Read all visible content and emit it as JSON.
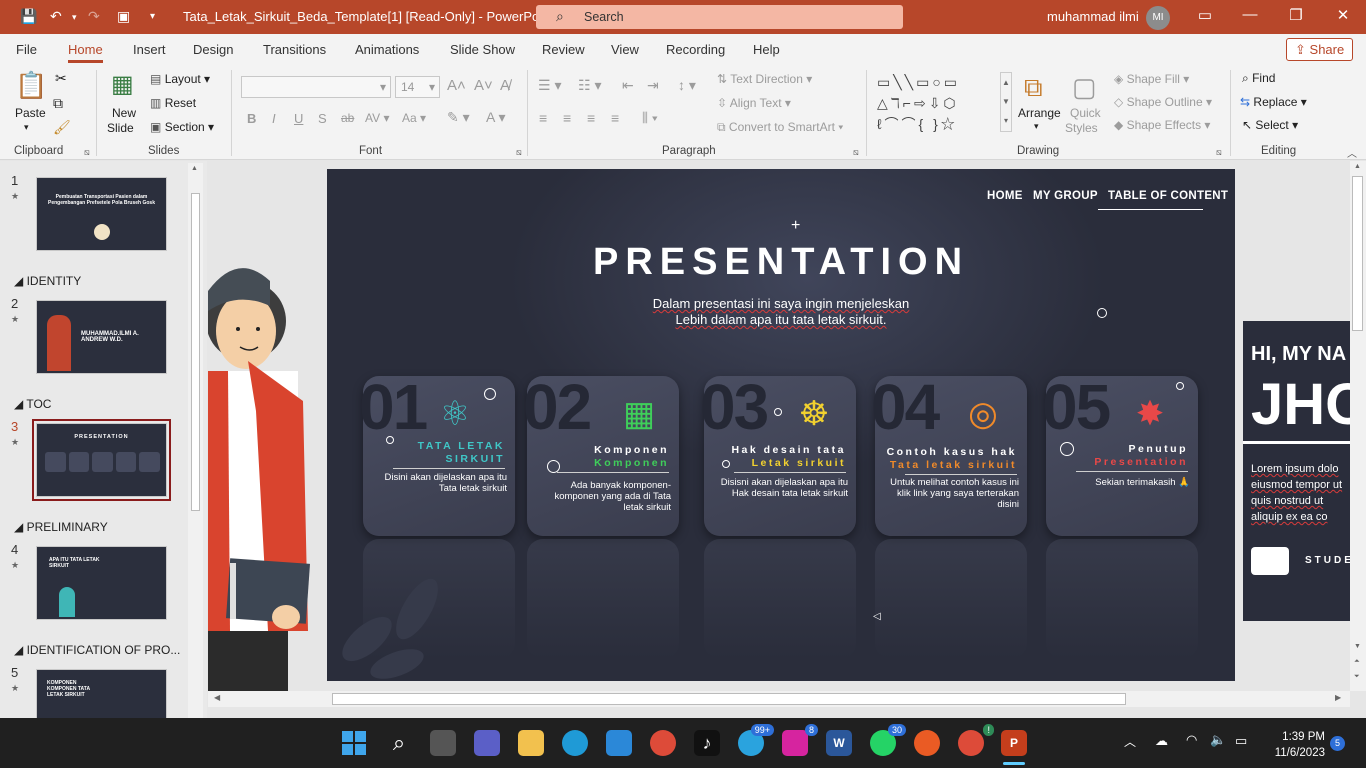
{
  "titlebar": {
    "filename": "Tata_Letak_Sirkuit_Beda_Template[1] [Read-Only]  -  PowerPoint",
    "search_placeholder": "Search",
    "user_name": "muhammad ilmi",
    "user_initials": "MI"
  },
  "menu": {
    "tabs": [
      "File",
      "Home",
      "Insert",
      "Design",
      "Transitions",
      "Animations",
      "Slide Show",
      "Review",
      "View",
      "Recording",
      "Help"
    ],
    "active": "Home",
    "share": "Share"
  },
  "ribbon": {
    "clipboard": {
      "paste": "Paste",
      "label": "Clipboard"
    },
    "slides": {
      "new_slide_1": "New",
      "new_slide_2": "Slide",
      "layout": "Layout",
      "reset": "Reset",
      "section": "Section",
      "label": "Slides"
    },
    "font": {
      "size": "14",
      "label": "Font"
    },
    "paragraph": {
      "text_direction": "Text Direction",
      "align_text": "Align Text",
      "convert": "Convert to SmartArt",
      "label": "Paragraph"
    },
    "drawing": {
      "arrange": "Arrange",
      "quick_styles_1": "Quick",
      "quick_styles_2": "Styles",
      "shape_fill": "Shape Fill",
      "shape_outline": "Shape Outline",
      "shape_effects": "Shape Effects",
      "label": "Drawing"
    },
    "editing": {
      "find": "Find",
      "replace": "Replace",
      "select": "Select",
      "label": "Editing"
    }
  },
  "thumbnails": {
    "sections": [
      "IDENTITY",
      "TOC",
      "PRELIMINARY",
      "IDENTIFICATION OF PRO..."
    ],
    "slides": [
      {
        "num": "1",
        "text": "Pembuatan Transportasi Pasien dalam Pengembangan Prefsetele Pola Bruseh Gosk"
      },
      {
        "num": "2",
        "text": "MUHAMMAD.ILMI A. ANDREW W.D."
      },
      {
        "num": "3",
        "text": "PRESENTATION"
      },
      {
        "num": "4",
        "text": "APA ITU TATA LETAK SIRKUIT"
      },
      {
        "num": "5",
        "text": "KOMPONEN KOMPONEN TATA LETAK SIRKUIT"
      }
    ],
    "selected": "3"
  },
  "slide": {
    "nav": [
      "HOME",
      "MY GROUP",
      "TABLE OF CONTENT"
    ],
    "title": "PRESENTATION",
    "subtitle_1": "Dalam presentasi ini saya ingin menjeleskan",
    "subtitle_2": "Lebih dalam apa itu tata letak sirkuit.",
    "cards": [
      {
        "num": "01",
        "t1": "TATA LETAK",
        "t2": "SIRKUIT",
        "desc": "Disini akan dijelaskan apa itu Tata letak sirkuit",
        "t1color": "#3fc7c7",
        "t2color": "#3fc7c7",
        "icon": "atom-icon"
      },
      {
        "num": "02",
        "t1": "Komponen",
        "t2": "Komponen",
        "desc": "Ada banyak komponen-komponen yang ada di Tata letak sirkuit",
        "t1color": "#ffffff",
        "t2color": "#3fcf5a",
        "icon": "maze-icon"
      },
      {
        "num": "03",
        "t1": "Hak desain tata",
        "t2": "Letak sirkuit",
        "desc": "Disisni akan dijelaskan apa itu Hak desain tata letak sirkuit",
        "t1color": "#ffffff",
        "t2color": "#f2d12f",
        "icon": "fingerprint-icon"
      },
      {
        "num": "04",
        "t1": "Contoh kasus hak",
        "t2": "Tata letak sirkuit",
        "desc": "Untuk melihat contoh kasus ini klik link yang saya terterakan disini",
        "t1color": "#ffffff",
        "t2color": "#f08a2a",
        "icon": "target-icon"
      },
      {
        "num": "05",
        "t1": "Penutup",
        "t2": "Presentation",
        "desc": "Sekian terimakasih 🙏",
        "t1color": "#ffffff",
        "t2color": "#e84848",
        "icon": "paint-splash-icon"
      }
    ]
  },
  "next_slide_preview": {
    "title": "HI, MY NA",
    "big": "JHO",
    "body": "Lorem ipsum dolo eiusmod tempor ut quis nostrud ut aliquip ex ea co",
    "label": "STUDE"
  },
  "taskbar": {
    "badges": {
      "telegram": "99+",
      "instagram": "8",
      "whatsapp": "30",
      "chrome2": "!"
    },
    "time": "1:39 PM",
    "date": "11/6/2023",
    "notifications": "5"
  }
}
